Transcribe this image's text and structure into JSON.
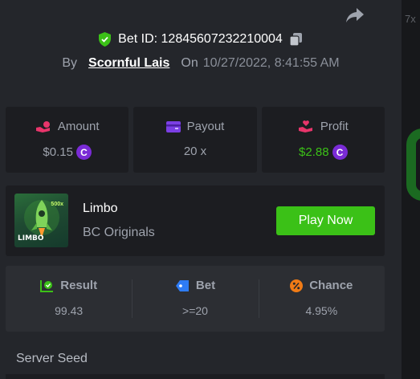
{
  "bet": {
    "label": "Bet ID:",
    "id": "12845607232210004",
    "by_label": "By",
    "user": "Scornful Lais",
    "on_label": "On",
    "date": "10/27/2022, 8:41:55 AM"
  },
  "stats": [
    {
      "label": "Amount",
      "value": "$0.15",
      "icon": "hand-coins-icon",
      "currency_icon": "bc-coin-icon",
      "color": "#e8356b"
    },
    {
      "label": "Payout",
      "value": "20 x",
      "icon": "wallet-icon",
      "color": "#7b3fe4"
    },
    {
      "label": "Profit",
      "value": "$2.88",
      "icon": "hand-heart-icon",
      "currency_icon": "bc-coin-icon",
      "color": "#e8356b",
      "value_color": "#3bc117"
    }
  ],
  "game": {
    "name": "Limbo",
    "provider": "BC Originals",
    "thumb_label": "LIMBO",
    "thumb_multiplier": "500x",
    "play_label": "Play Now"
  },
  "result": [
    {
      "label": "Result",
      "value": "99.43",
      "icon": "chart-check-icon",
      "color": "#3bc117"
    },
    {
      "label": "Bet",
      "value": ">=20",
      "icon": "tag-icon",
      "color": "#2e7cf6"
    },
    {
      "label": "Chance",
      "value": "4.95%",
      "icon": "percent-icon",
      "color": "#f07b16"
    }
  ],
  "server_seed": {
    "label": "Server Seed"
  },
  "side": {
    "hint": "7x"
  },
  "colors": {
    "accent": "#3bc117",
    "panel_bg": "#24262b",
    "card_bg": "#1c1d21",
    "coin": "#7a2bd6"
  }
}
